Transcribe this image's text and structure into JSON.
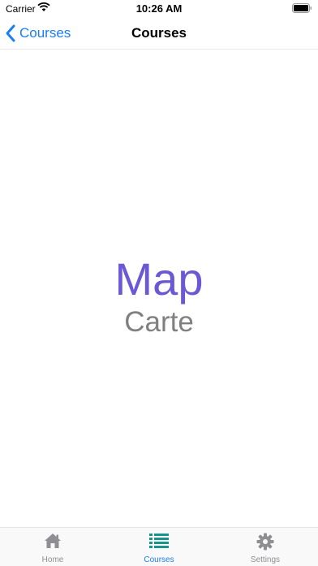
{
  "status_bar": {
    "carrier": "Carrier",
    "time": "10:26 AM"
  },
  "nav": {
    "back_label": "Courses",
    "title": "Courses"
  },
  "content": {
    "word": "Map",
    "translation": "Carte"
  },
  "tabs": [
    {
      "label": "Home",
      "icon": "house-icon",
      "active": false
    },
    {
      "label": "Courses",
      "icon": "list-icon",
      "active": true
    },
    {
      "label": "Settings",
      "icon": "gear-icon",
      "active": false
    }
  ],
  "colors": {
    "accent": "#1a7ef4",
    "word": "#6a58d6",
    "courses_icon": "#19948a"
  }
}
